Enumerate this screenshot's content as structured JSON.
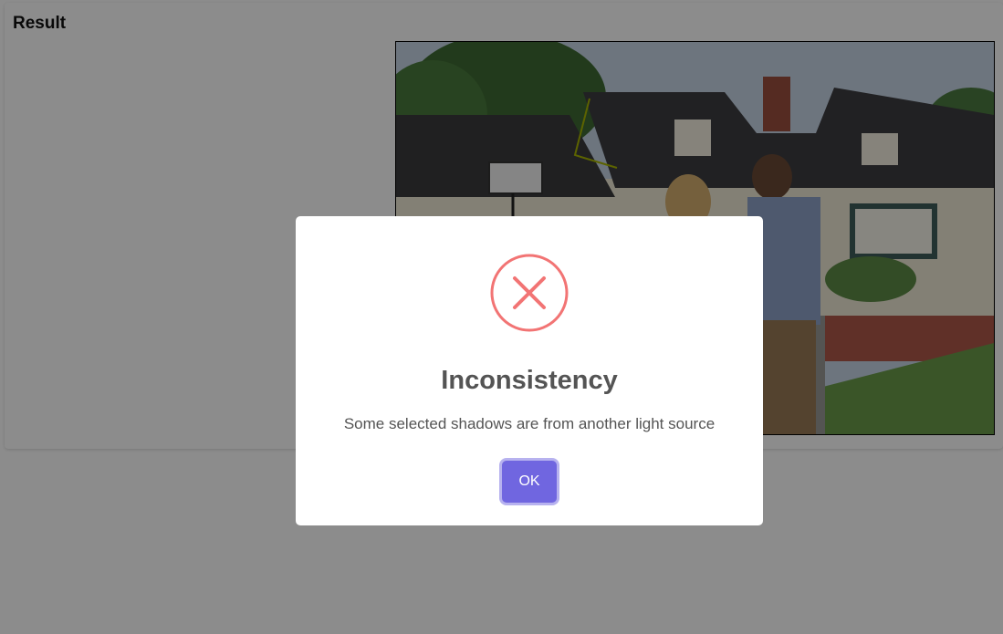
{
  "result": {
    "title": "Result"
  },
  "scene_image": {
    "description_icon": "photo-icon"
  },
  "dialog": {
    "icon": "error-x-icon",
    "icon_color": "#f27474",
    "title": "Inconsistency",
    "message": "Some selected shadows are from another light source",
    "ok_label": "OK",
    "ok_color": "#7066e0"
  },
  "colors": {
    "overlay": "rgba(0,0,0,0.45)",
    "card_background": "#ffffff",
    "shadow_line": "#a8b400"
  }
}
